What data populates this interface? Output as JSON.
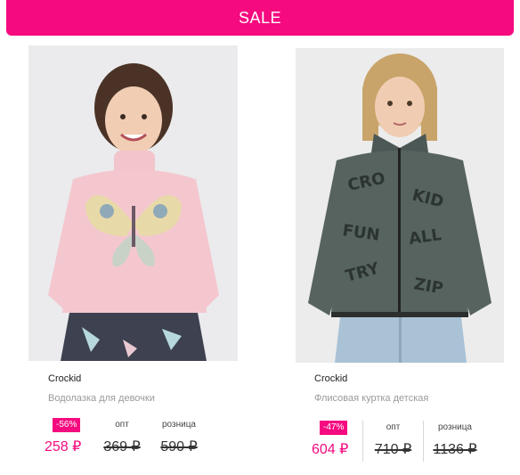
{
  "sale_button": {
    "label": "SALE"
  },
  "colors": {
    "accent": "#f50a7f",
    "muted": "#9a9a9a"
  },
  "products": [
    {
      "brand": "Crockid",
      "title": "Водолазка для девочки",
      "discount": "-56%",
      "price_now": "258 ₽",
      "opt_label": "опт",
      "opt_price": "369 ₽",
      "retail_label": "розница",
      "retail_price": "590 ₽"
    },
    {
      "brand": "Crockid",
      "title": "Флисовая куртка детская",
      "discount": "-47%",
      "price_now": "604 ₽",
      "opt_label": "опт",
      "opt_price": "710 ₽",
      "retail_label": "розница",
      "retail_price": "1136 ₽"
    }
  ]
}
